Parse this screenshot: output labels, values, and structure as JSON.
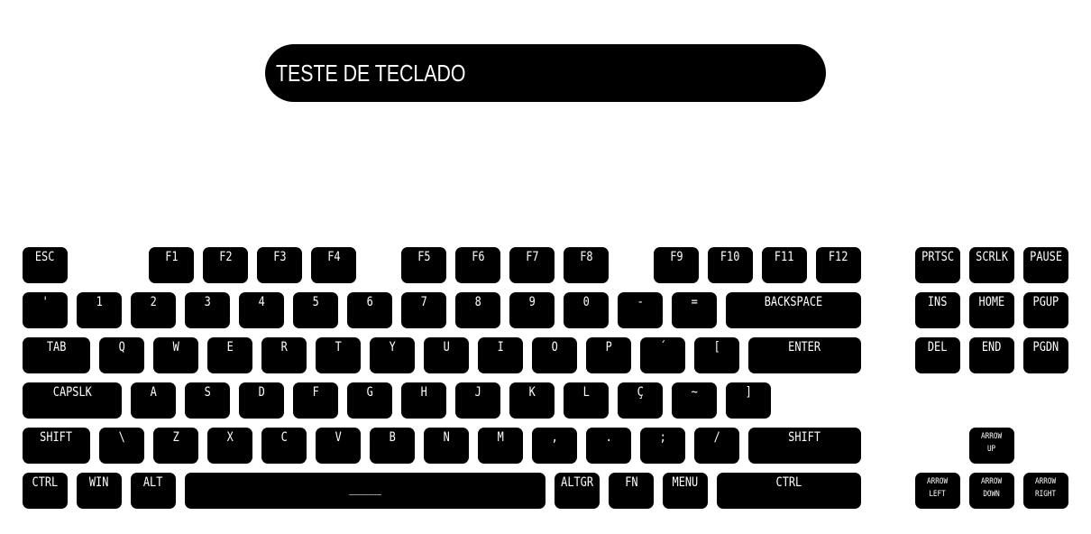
{
  "title": "TESTE DE TECLADO",
  "keys": {
    "esc": "ESC",
    "f1": "F1",
    "f2": "F2",
    "f3": "F3",
    "f4": "F4",
    "f5": "F5",
    "f6": "F6",
    "f7": "F7",
    "f8": "F8",
    "f9": "F9",
    "f10": "F10",
    "f11": "F11",
    "f12": "F12",
    "prtsc": "PRTSC",
    "scrlk": "SCRLK",
    "pause": "PAUSE",
    "apostrophe": "'",
    "k1": "1",
    "k2": "2",
    "k3": "3",
    "k4": "4",
    "k5": "5",
    "k6": "6",
    "k7": "7",
    "k8": "8",
    "k9": "9",
    "k0": "0",
    "minus": "-",
    "equals": "=",
    "backspace": "BACKSPACE",
    "ins": "INS",
    "home": "HOME",
    "pgup": "PGUP",
    "tab": "TAB",
    "q": "Q",
    "w": "W",
    "e": "E",
    "r": "R",
    "t": "T",
    "y": "Y",
    "u": "U",
    "i": "I",
    "o": "O",
    "p": "P",
    "acute": "´",
    "lbracket": "[",
    "enter": "ENTER",
    "del": "DEL",
    "end": "END",
    "pgdn": "PGDN",
    "capslk": "CAPSLK",
    "a": "A",
    "s": "S",
    "d": "D",
    "f": "F",
    "g": "G",
    "h": "H",
    "j": "J",
    "k": "K",
    "l": "L",
    "cedilla": "Ç",
    "tilde": "~",
    "rbracket": "]",
    "shift_left": "SHIFT",
    "backslash": "\\",
    "z": "Z",
    "x": "X",
    "c": "C",
    "v": "V",
    "b": "B",
    "n": "N",
    "m": "M",
    "comma": ",",
    "period": ".",
    "semicolon": ";",
    "slash": "/",
    "shift_right": "SHIFT",
    "arrow_up": "ARROW\nUP",
    "ctrl_left": "CTRL",
    "win": "WIN",
    "alt": "ALT",
    "space": "_____",
    "altgr": "ALTGR",
    "fn": "FN",
    "menu": "MENU",
    "ctrl_right": "CTRL",
    "arrow_left": "ARROW\nLEFT",
    "arrow_down": "ARROW\nDOWN",
    "arrow_right": "ARROW\nRIGHT"
  }
}
